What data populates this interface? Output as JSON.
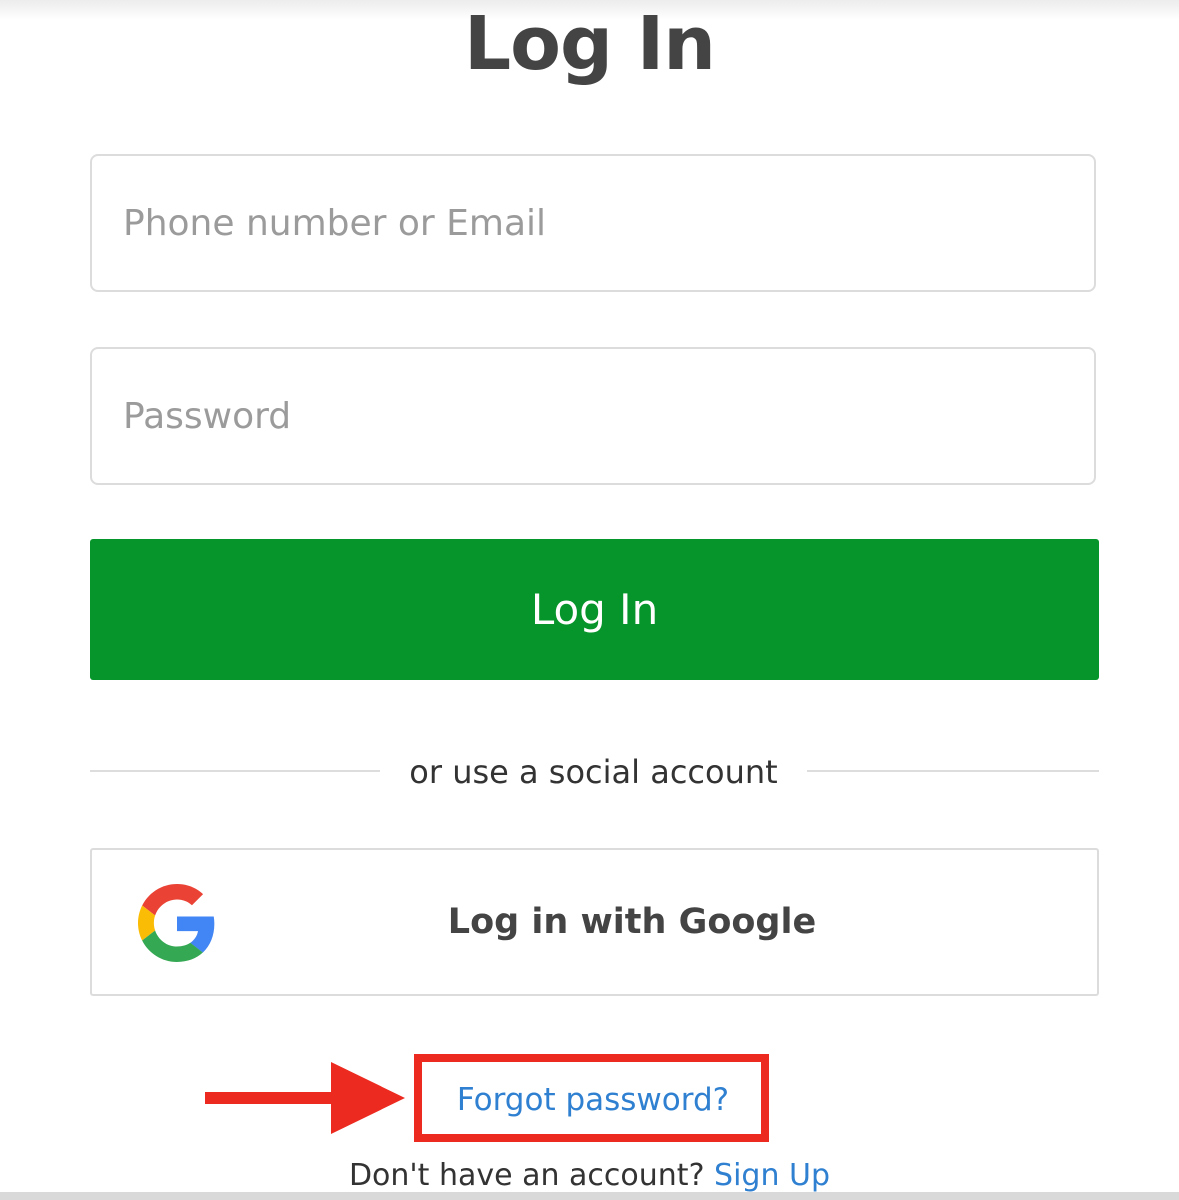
{
  "page": {
    "title": "Log In"
  },
  "form": {
    "email_placeholder": "Phone number or Email",
    "password_placeholder": "Password",
    "login_button_label": "Log In"
  },
  "social": {
    "divider_text": "or use a social account",
    "google_button_label": "Log in with Google",
    "google_icon": "google-g-logo"
  },
  "links": {
    "forgot_password": "Forgot password?",
    "no_account_prompt": "Don't have an account?",
    "sign_up": "Sign Up"
  },
  "annotation": {
    "highlight_color": "#ec2a1f",
    "arrow_icon": "right-arrow"
  },
  "colors": {
    "primary_green": "#05952a",
    "link_blue": "#2f80d1",
    "title_gray": "#444444"
  }
}
